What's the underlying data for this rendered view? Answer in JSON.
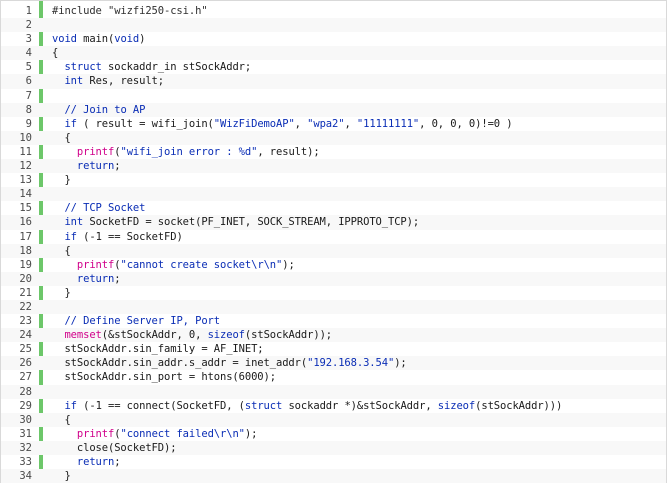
{
  "colors": {
    "keyword": "#0a2db5",
    "string": "#0a2db5",
    "comment": "#0a2db5",
    "function": "#d0008a",
    "plain": "#1a1a1a",
    "gutter_bar": "#6dc76a"
  },
  "lines": [
    {
      "n": "1",
      "tokens": [
        {
          "t": "#include \"wizfi250-csi.h\"",
          "k": "pp"
        }
      ]
    },
    {
      "n": "2",
      "tokens": []
    },
    {
      "n": "3",
      "tokens": [
        {
          "t": "void",
          "k": "kw"
        },
        {
          "t": " main(",
          "k": "plain"
        },
        {
          "t": "void",
          "k": "kw"
        },
        {
          "t": ")",
          "k": "plain"
        }
      ]
    },
    {
      "n": "4",
      "tokens": [
        {
          "t": "{",
          "k": "plain"
        }
      ]
    },
    {
      "n": "5",
      "tokens": [
        {
          "t": "  ",
          "k": "plain"
        },
        {
          "t": "struct",
          "k": "kw"
        },
        {
          "t": " sockaddr_in stSockAddr;",
          "k": "plain"
        }
      ]
    },
    {
      "n": "6",
      "tokens": [
        {
          "t": "  ",
          "k": "plain"
        },
        {
          "t": "int",
          "k": "kw"
        },
        {
          "t": " Res, result;",
          "k": "plain"
        }
      ]
    },
    {
      "n": "7",
      "tokens": []
    },
    {
      "n": "8",
      "tokens": [
        {
          "t": "  ",
          "k": "plain"
        },
        {
          "t": "// Join to AP",
          "k": "cm"
        }
      ]
    },
    {
      "n": "9",
      "tokens": [
        {
          "t": "  ",
          "k": "plain"
        },
        {
          "t": "if",
          "k": "kw"
        },
        {
          "t": " ( result = wifi_join(",
          "k": "plain"
        },
        {
          "t": "\"WizFiDemoAP\"",
          "k": "str"
        },
        {
          "t": ", ",
          "k": "plain"
        },
        {
          "t": "\"wpa2\"",
          "k": "str"
        },
        {
          "t": ", ",
          "k": "plain"
        },
        {
          "t": "\"11111111\"",
          "k": "str"
        },
        {
          "t": ", 0, 0, 0)!=0 )",
          "k": "plain"
        }
      ]
    },
    {
      "n": "10",
      "tokens": [
        {
          "t": "  {",
          "k": "plain"
        }
      ]
    },
    {
      "n": "11",
      "tokens": [
        {
          "t": "    ",
          "k": "plain"
        },
        {
          "t": "printf",
          "k": "fn"
        },
        {
          "t": "(",
          "k": "plain"
        },
        {
          "t": "\"wifi_join error : %d\"",
          "k": "str"
        },
        {
          "t": ", result);",
          "k": "plain"
        }
      ]
    },
    {
      "n": "12",
      "tokens": [
        {
          "t": "    ",
          "k": "plain"
        },
        {
          "t": "return",
          "k": "kw"
        },
        {
          "t": ";",
          "k": "plain"
        }
      ]
    },
    {
      "n": "13",
      "tokens": [
        {
          "t": "  }",
          "k": "plain"
        }
      ]
    },
    {
      "n": "14",
      "tokens": []
    },
    {
      "n": "15",
      "tokens": [
        {
          "t": "  ",
          "k": "plain"
        },
        {
          "t": "// TCP Socket",
          "k": "cm"
        }
      ]
    },
    {
      "n": "16",
      "tokens": [
        {
          "t": "  ",
          "k": "plain"
        },
        {
          "t": "int",
          "k": "kw"
        },
        {
          "t": " SocketFD = socket(PF_INET, SOCK_STREAM, IPPROTO_TCP);",
          "k": "plain"
        }
      ]
    },
    {
      "n": "17",
      "tokens": [
        {
          "t": "  ",
          "k": "plain"
        },
        {
          "t": "if",
          "k": "kw"
        },
        {
          "t": " (-1 == SocketFD)",
          "k": "plain"
        }
      ]
    },
    {
      "n": "18",
      "tokens": [
        {
          "t": "  {",
          "k": "plain"
        }
      ]
    },
    {
      "n": "19",
      "tokens": [
        {
          "t": "    ",
          "k": "plain"
        },
        {
          "t": "printf",
          "k": "fn"
        },
        {
          "t": "(",
          "k": "plain"
        },
        {
          "t": "\"cannot create socket\\r\\n\"",
          "k": "str"
        },
        {
          "t": ");",
          "k": "plain"
        }
      ]
    },
    {
      "n": "20",
      "tokens": [
        {
          "t": "    ",
          "k": "plain"
        },
        {
          "t": "return",
          "k": "kw"
        },
        {
          "t": ";",
          "k": "plain"
        }
      ]
    },
    {
      "n": "21",
      "tokens": [
        {
          "t": "  }",
          "k": "plain"
        }
      ]
    },
    {
      "n": "22",
      "tokens": []
    },
    {
      "n": "23",
      "tokens": [
        {
          "t": "  ",
          "k": "plain"
        },
        {
          "t": "// Define Server IP, Port",
          "k": "cm"
        }
      ]
    },
    {
      "n": "24",
      "tokens": [
        {
          "t": "  ",
          "k": "plain"
        },
        {
          "t": "memset",
          "k": "fn"
        },
        {
          "t": "(&stSockAddr, 0, ",
          "k": "plain"
        },
        {
          "t": "sizeof",
          "k": "kw"
        },
        {
          "t": "(stSockAddr));",
          "k": "plain"
        }
      ]
    },
    {
      "n": "25",
      "tokens": [
        {
          "t": "  stSockAddr.sin_family = AF_INET;",
          "k": "plain"
        }
      ]
    },
    {
      "n": "26",
      "tokens": [
        {
          "t": "  stSockAddr.sin_addr.s_addr = inet_addr(",
          "k": "plain"
        },
        {
          "t": "\"192.168.3.54\"",
          "k": "str"
        },
        {
          "t": ");",
          "k": "plain"
        }
      ]
    },
    {
      "n": "27",
      "tokens": [
        {
          "t": "  stSockAddr.sin_port = htons(6000);",
          "k": "plain"
        }
      ]
    },
    {
      "n": "28",
      "tokens": []
    },
    {
      "n": "29",
      "tokens": [
        {
          "t": "  ",
          "k": "plain"
        },
        {
          "t": "if",
          "k": "kw"
        },
        {
          "t": " (-1 == connect(SocketFD, (",
          "k": "plain"
        },
        {
          "t": "struct",
          "k": "kw"
        },
        {
          "t": " sockaddr *)&stSockAddr, ",
          "k": "plain"
        },
        {
          "t": "sizeof",
          "k": "kw"
        },
        {
          "t": "(stSockAddr)))",
          "k": "plain"
        }
      ]
    },
    {
      "n": "30",
      "tokens": [
        {
          "t": "  {",
          "k": "plain"
        }
      ]
    },
    {
      "n": "31",
      "tokens": [
        {
          "t": "    ",
          "k": "plain"
        },
        {
          "t": "printf",
          "k": "fn"
        },
        {
          "t": "(",
          "k": "plain"
        },
        {
          "t": "\"connect failed\\r\\n\"",
          "k": "str"
        },
        {
          "t": ");",
          "k": "plain"
        }
      ]
    },
    {
      "n": "32",
      "tokens": [
        {
          "t": "    close(SocketFD);",
          "k": "plain"
        }
      ]
    },
    {
      "n": "33",
      "tokens": [
        {
          "t": "    ",
          "k": "plain"
        },
        {
          "t": "return",
          "k": "kw"
        },
        {
          "t": ";",
          "k": "plain"
        }
      ]
    },
    {
      "n": "34",
      "tokens": [
        {
          "t": "  }",
          "k": "plain"
        }
      ]
    }
  ]
}
